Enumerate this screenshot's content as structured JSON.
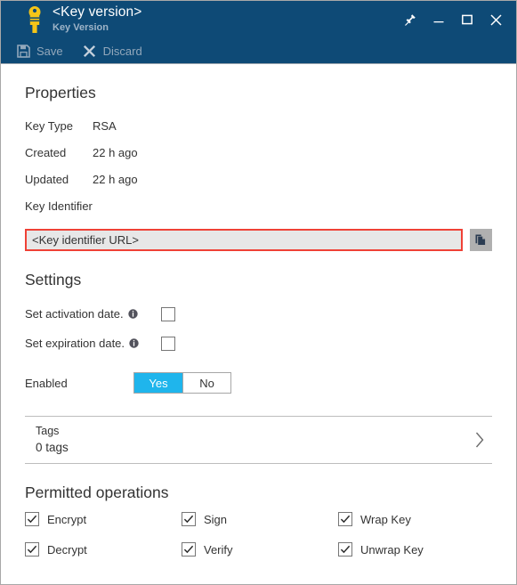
{
  "window": {
    "titlebar": {
      "icon": "key-icon",
      "title": "<Key version>",
      "subtitle": "Key Version",
      "buttons": [
        {
          "name": "pin-icon",
          "label": "Pin"
        },
        {
          "name": "minimize-icon",
          "label": "Minimize"
        },
        {
          "name": "maximize-icon",
          "label": "Maximize"
        },
        {
          "name": "close-icon",
          "label": "Close"
        }
      ]
    },
    "commandbar": {
      "save_label": "Save",
      "save_icon": "save-floppy-icon",
      "discard_label": "Discard",
      "discard_icon": "discard-x-icon"
    }
  },
  "properties": {
    "heading": "Properties",
    "rows": [
      {
        "label": "Key Type",
        "value": "RSA"
      },
      {
        "label": "Created",
        "value": "22 h ago"
      },
      {
        "label": "Updated",
        "value": "22 h ago"
      },
      {
        "label": "Key Identifier",
        "value": ""
      }
    ],
    "key_identifier": {
      "value": "<Key identifier URL>",
      "placeholder": "<Key identifier URL>",
      "copy_icon": "copy-icon",
      "highlight_color": "#ef4136",
      "field_background": "#e7e7e7"
    }
  },
  "settings": {
    "heading": "Settings",
    "activation": {
      "label": "Set activation date.",
      "info_icon": "info-icon",
      "checked": false
    },
    "expiration": {
      "label": "Set expiration date.",
      "info_icon": "info-icon",
      "checked": false
    },
    "enabled": {
      "label": "Enabled",
      "options": [
        "Yes",
        "No"
      ],
      "yes_label": "Yes",
      "no_label": "No",
      "selected": "Yes",
      "accent_color": "#1fb5ec"
    }
  },
  "tags": {
    "title": "Tags",
    "count_label": "0 tags",
    "chevron_icon": "chevron-right-icon"
  },
  "permitted_operations": {
    "heading": "Permitted operations",
    "items": [
      {
        "label": "Encrypt",
        "checked": true
      },
      {
        "label": "Sign",
        "checked": true
      },
      {
        "label": "Wrap Key",
        "checked": true
      },
      {
        "label": "Decrypt",
        "checked": true
      },
      {
        "label": "Verify",
        "checked": true
      },
      {
        "label": "Unwrap Key",
        "checked": true
      }
    ]
  },
  "colors": {
    "titlebar_blue": "#0e4a76",
    "accent_cyan": "#1fb5ec",
    "alert_red": "#ef4136",
    "key_gold": "#f0c419"
  }
}
